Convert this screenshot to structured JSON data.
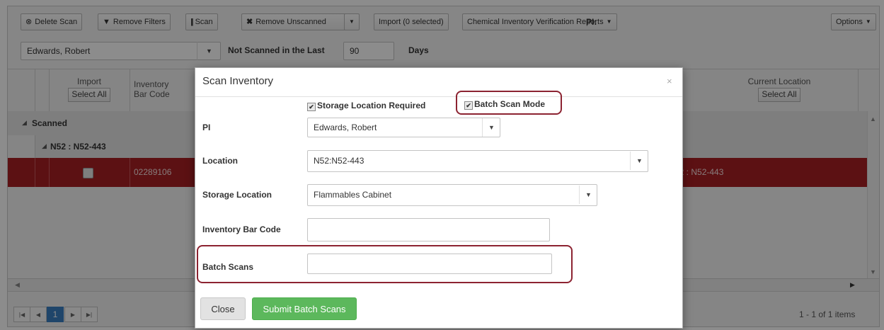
{
  "toolbar": {
    "delete_scan": "Delete Scan",
    "remove_filters": "Remove Filters",
    "scan": "Scan",
    "remove_unscanned": "Remove Unscanned",
    "import": "Import (0 selected)",
    "reports": "Chemical Inventory Verification Reports",
    "pi_label": "PI:",
    "options": "Options",
    "pi_value": "Edwards, Robert",
    "not_scanned_label": "Not Scanned in the Last",
    "days_value": "90",
    "days_label": "Days"
  },
  "grid": {
    "headers": {
      "import": "Import",
      "import_select_all": "Select All",
      "barcode_line1": "Inventory",
      "barcode_line2": "Bar Code",
      "current_location": "Current Location",
      "location_select_all": "Select All"
    },
    "group_scanned": "Scanned",
    "group_location": "N52 : N52-443",
    "row": {
      "barcode": "02289106",
      "location_fragment": "52 : N52-443"
    },
    "pager": {
      "current_page": "1",
      "summary": "1 - 1 of 1 items"
    }
  },
  "modal": {
    "title": "Scan Inventory",
    "storage_required": "Storage Location Required",
    "batch_scan_mode": "Batch Scan Mode",
    "pi_label": "PI",
    "pi_value": "Edwards, Robert",
    "location_label": "Location",
    "location_value": "N52:N52-443",
    "storage_label": "Storage Location",
    "storage_value": "Flammables Cabinet",
    "barcode_label": "Inventory Bar Code",
    "barcode_value": "",
    "batch_label": "Batch Scans",
    "batch_value": "",
    "close_label": "Close",
    "submit_label": "Submit Batch Scans"
  },
  "colors": {
    "selected_row": "#a81f24",
    "highlight": "#8c2331",
    "submit": "#5cb85c"
  },
  "icons": {
    "delete_scan": "circle-x-icon",
    "remove_filters": "filter-icon",
    "scan": "barcode-icon",
    "remove_unscanned": "x-icon"
  }
}
